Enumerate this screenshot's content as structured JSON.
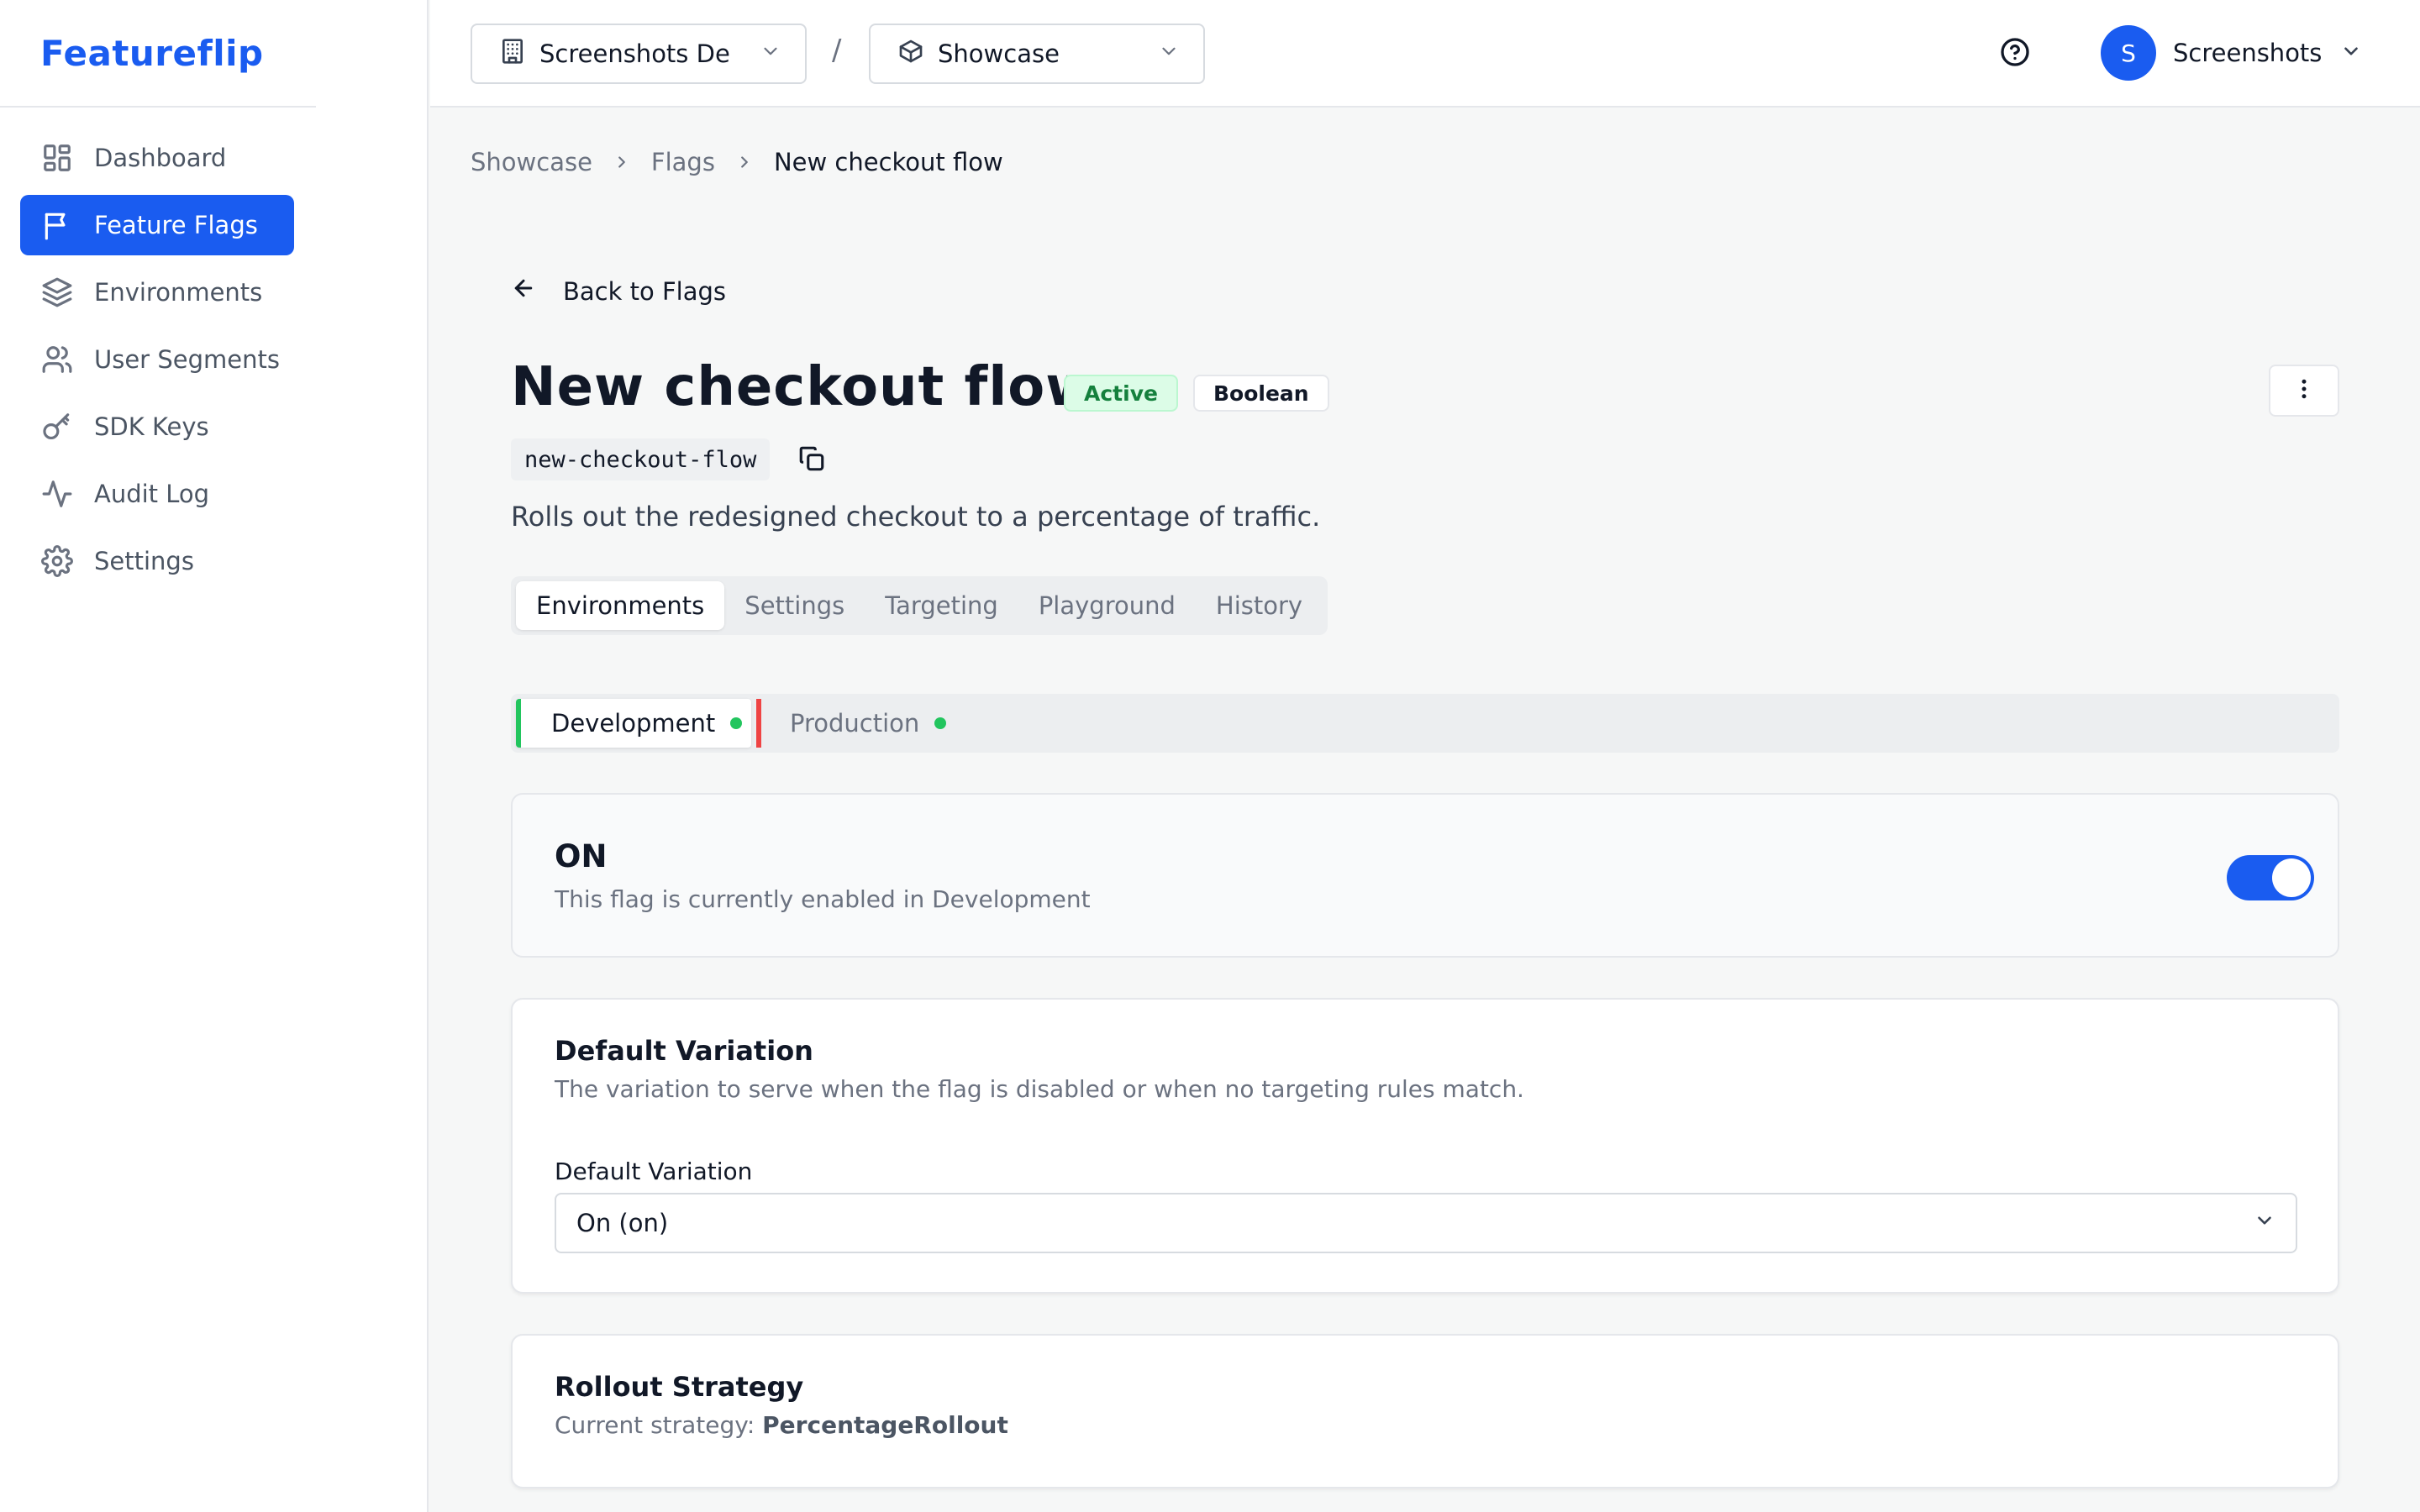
{
  "brand": "Featureflip",
  "colors": {
    "accent": "#1a5cf0",
    "success": "#22c55e",
    "danger": "#ef4444"
  },
  "sidebar": {
    "items": [
      {
        "label": "Dashboard",
        "icon": "dashboard-icon",
        "active": false
      },
      {
        "label": "Feature Flags",
        "icon": "flag-icon",
        "active": true
      },
      {
        "label": "Environments",
        "icon": "layers-icon",
        "active": false
      },
      {
        "label": "User Segments",
        "icon": "users-icon",
        "active": false
      },
      {
        "label": "SDK Keys",
        "icon": "key-icon",
        "active": false
      },
      {
        "label": "Audit Log",
        "icon": "activity-icon",
        "active": false
      },
      {
        "label": "Settings",
        "icon": "gear-icon",
        "active": false
      }
    ]
  },
  "topbar": {
    "org": "Screenshots De",
    "separator": "/",
    "project": "Showcase",
    "avatar_initial": "S",
    "user_name": "Screenshots"
  },
  "breadcrumb": {
    "items": [
      "Showcase",
      "Flags",
      "New checkout flow"
    ]
  },
  "back_label": "Back to Flags",
  "flag": {
    "name": "New checkout flow",
    "status_badge": "Active",
    "type_badge": "Boolean",
    "key": "new-checkout-flow",
    "description": "Rolls out the redesigned checkout to a percentage of traffic."
  },
  "tabs": [
    {
      "label": "Environments",
      "selected": true
    },
    {
      "label": "Settings",
      "selected": false
    },
    {
      "label": "Targeting",
      "selected": false
    },
    {
      "label": "Playground",
      "selected": false
    },
    {
      "label": "History",
      "selected": false
    }
  ],
  "environments": [
    {
      "label": "Development",
      "selected": true
    },
    {
      "label": "Production",
      "selected": false
    }
  ],
  "state_card": {
    "title": "ON",
    "subtitle": "This flag is currently enabled in Development",
    "enabled": true
  },
  "default_variation": {
    "title": "Default Variation",
    "subtitle": "The variation to serve when the flag is disabled or when no targeting rules match.",
    "field_label": "Default Variation",
    "value": "On (on)"
  },
  "rollout": {
    "title": "Rollout Strategy",
    "prefix": "Current strategy:",
    "strategy": "PercentageRollout"
  }
}
